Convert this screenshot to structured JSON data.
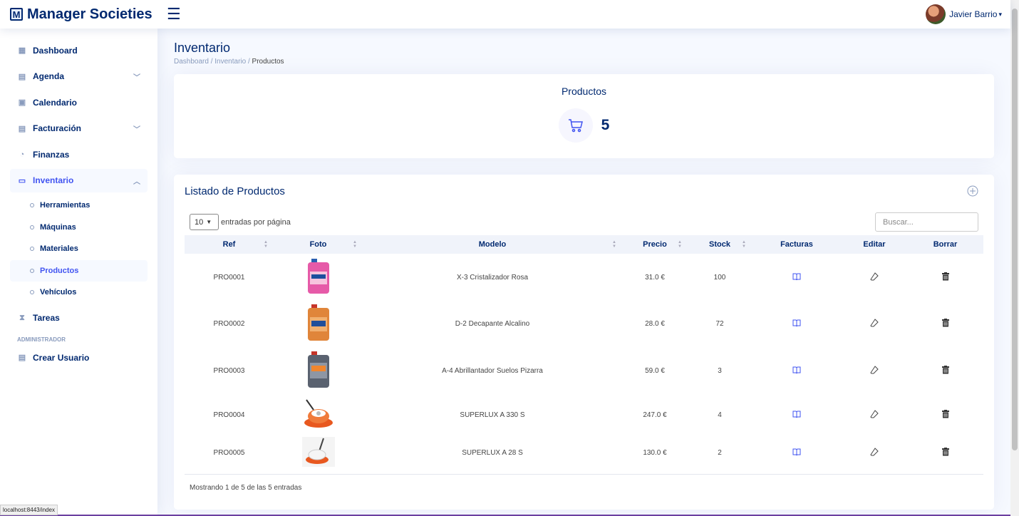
{
  "app": {
    "logo_letter": "M",
    "title": "Manager Societies"
  },
  "user": {
    "name": "Javier Barrio"
  },
  "sidebar": {
    "items": [
      {
        "label": "Dashboard",
        "icon": "grid-icon"
      },
      {
        "label": "Agenda",
        "icon": "journal-icon"
      },
      {
        "label": "Calendario",
        "icon": "calendar-icon"
      },
      {
        "label": "Facturación",
        "icon": "receipt-icon"
      },
      {
        "label": "Finanzas",
        "icon": "cash-icon"
      },
      {
        "label": "Inventario",
        "icon": "box-icon"
      }
    ],
    "sub_items": [
      {
        "label": "Herramientas"
      },
      {
        "label": "Máquinas"
      },
      {
        "label": "Materiales"
      },
      {
        "label": "Productos"
      },
      {
        "label": "Vehículos"
      }
    ],
    "tareas": "Tareas",
    "heading": "ADMINISTRADOR",
    "crear": "Crear Usuario"
  },
  "page": {
    "title": "Inventario",
    "breadcrumb": [
      "Dashboard",
      "Inventario",
      "Productos"
    ],
    "count_title": "Productos",
    "count_value": "5"
  },
  "list": {
    "title": "Listado de Productos",
    "page_size": "10",
    "per_page_label": "entradas por página",
    "search_placeholder": "Buscar...",
    "columns": [
      "Ref",
      "Foto",
      "Modelo",
      "Precio",
      "Stock",
      "Facturas",
      "Editar",
      "Borrar"
    ],
    "rows": [
      {
        "ref": "PRO0001",
        "modelo": "X-3 Cristalizador Rosa",
        "precio": "31.0 €",
        "stock": "100"
      },
      {
        "ref": "PRO0002",
        "modelo": "D-2 Decapante Alcalino",
        "precio": "28.0 €",
        "stock": "72"
      },
      {
        "ref": "PRO0003",
        "modelo": "A-4 Abrillantador Suelos Pizarra",
        "precio": "59.0 €",
        "stock": "3"
      },
      {
        "ref": "PRO0004",
        "modelo": "SUPERLUX A 330 S",
        "precio": "247.0 €",
        "stock": "4"
      },
      {
        "ref": "PRO0005",
        "modelo": "SUPERLUX A 28 S",
        "precio": "130.0 €",
        "stock": "2"
      }
    ],
    "footer": "Mostrando 1 de 5 de las 5 entradas"
  },
  "status_url": "localhost:8443/index",
  "colors": {
    "primary": "#4154f1",
    "navy": "#012970",
    "bg": "#f6f9ff"
  }
}
